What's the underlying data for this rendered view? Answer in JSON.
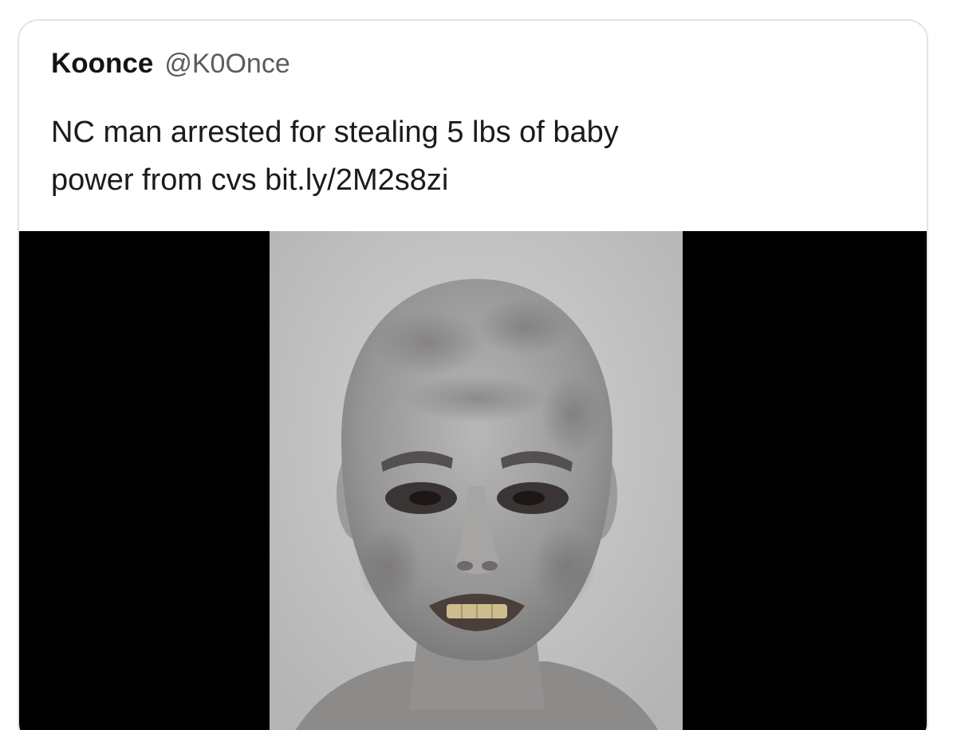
{
  "tweet": {
    "display_name": "Koonce",
    "handle": "@K0Once",
    "text_line_1": "NC man arrested for stealing 5 lbs of baby",
    "text_line_2_prefix": "power from cvs ",
    "link_text": "bit.ly/2M2s8zi"
  },
  "media": {
    "type": "photo",
    "colors": {
      "letterbox": "#000000",
      "backdrop": "#c8c8c8",
      "skin": "#9a9a9a"
    }
  }
}
